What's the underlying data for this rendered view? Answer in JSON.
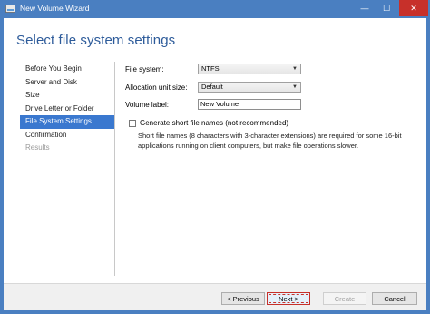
{
  "window": {
    "title": "New Volume Wizard",
    "minimize_glyph": "—",
    "maximize_glyph": "☐",
    "close_glyph": "✕"
  },
  "page": {
    "title": "Select file system settings"
  },
  "nav": {
    "items": [
      {
        "label": "Before You Begin",
        "state": "normal"
      },
      {
        "label": "Server and Disk",
        "state": "normal"
      },
      {
        "label": "Size",
        "state": "normal"
      },
      {
        "label": "Drive Letter or Folder",
        "state": "normal"
      },
      {
        "label": "File System Settings",
        "state": "active"
      },
      {
        "label": "Confirmation",
        "state": "normal"
      },
      {
        "label": "Results",
        "state": "disabled"
      }
    ]
  },
  "form": {
    "file_system_label": "File system:",
    "file_system_value": "NTFS",
    "allocation_label": "Allocation unit size:",
    "allocation_value": "Default",
    "volume_label_label": "Volume label:",
    "volume_label_value": "New Volume",
    "short_names_label": "Generate short file names (not recommended)",
    "short_names_checked": false,
    "short_names_description": "Short file names (8 characters with 3-character extensions) are required for some 16-bit applications running on client computers, but make file operations slower."
  },
  "buttons": {
    "previous": "< Previous",
    "next": "Next >",
    "create": "Create",
    "cancel": "Cancel"
  },
  "colors": {
    "titlebar": "#4a7fc1",
    "accent": "#2d5b9a",
    "nav_active": "#3a78cf",
    "close_button": "#c7302a"
  }
}
